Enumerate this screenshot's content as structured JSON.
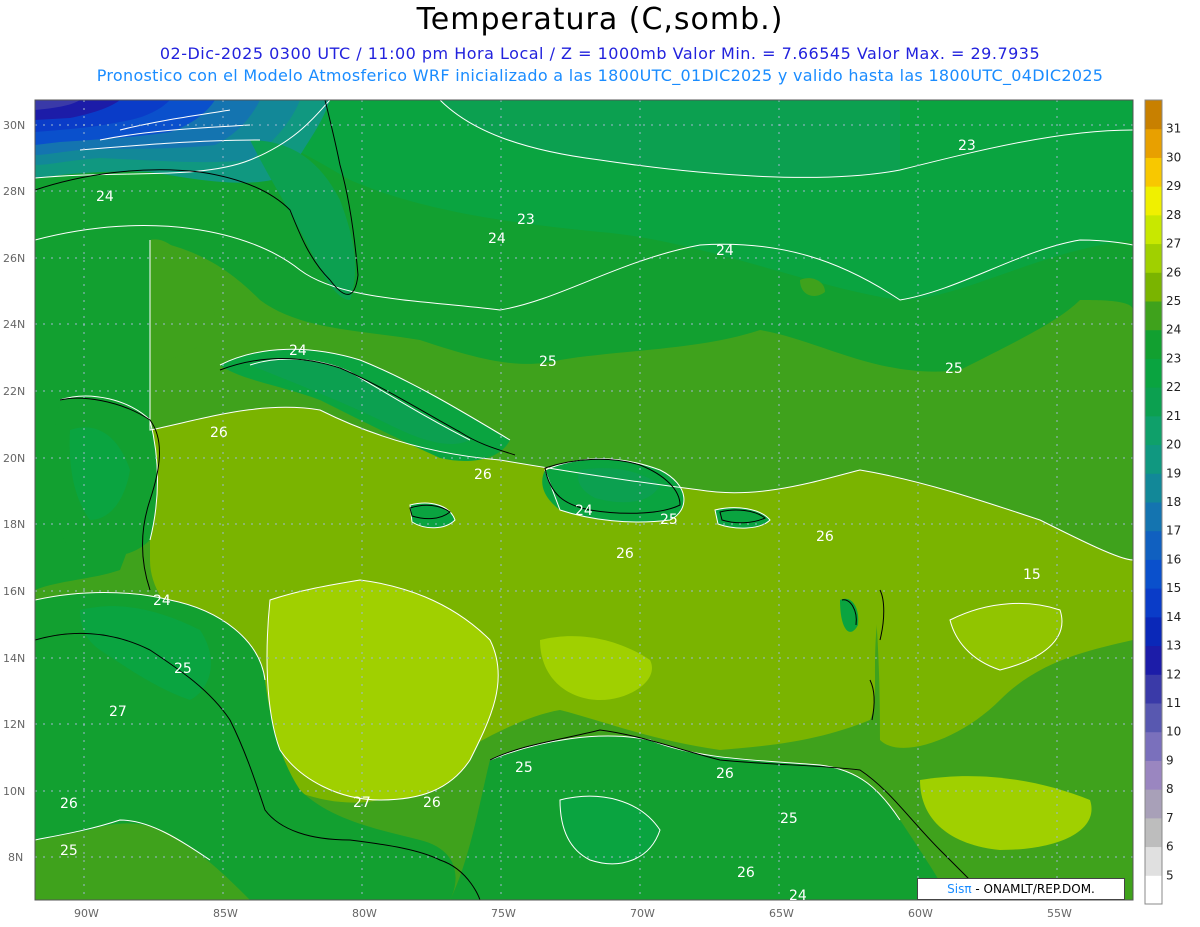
{
  "header": {
    "title": "Temperatura (C,somb.)",
    "line1": "02-Dic-2025 0300 UTC / 11:00 pm Hora Local / Z = 1000mb  Valor Min. = 7.66545  Valor Max. = 29.7935",
    "line2": "Pronostico con el Modelo Atmosferico WRF inicializado a las 1800UTC_01DIC2025 y valido hasta las  1800UTC_04DIC2025"
  },
  "map": {
    "lat_ticks": [
      "30N",
      "28N",
      "26N",
      "24N",
      "22N",
      "20N",
      "18N",
      "16N",
      "14N",
      "12N",
      "10N",
      "8N"
    ],
    "lon_ticks": [
      "90W",
      "85W",
      "80W",
      "75W",
      "70W",
      "65W",
      "60W",
      "55W"
    ],
    "contour_labels": [
      "24",
      "23",
      "24",
      "24",
      "23",
      "24",
      "25",
      "25",
      "26",
      "26",
      "24",
      "25",
      "26",
      "26",
      "15",
      "24",
      "25",
      "27",
      "26",
      "27",
      "26",
      "25",
      "25",
      "26",
      "25",
      "26",
      "24"
    ]
  },
  "colorbar": {
    "levels": [
      5,
      6,
      7,
      8,
      9,
      10,
      11,
      12,
      13,
      14,
      15,
      16,
      17,
      18,
      19,
      20,
      21,
      22,
      23,
      24,
      25,
      26,
      27,
      28,
      29,
      30,
      31
    ],
    "labels": [
      "5",
      "6",
      "7",
      "8",
      "9",
      "10",
      "11",
      "12",
      "13",
      "14",
      "15",
      "16",
      "17",
      "18",
      "19",
      "20",
      "21",
      "22",
      "23",
      "24",
      "25",
      "26",
      "27",
      "28",
      "29",
      "30",
      "31"
    ],
    "colors": [
      "#ffffff",
      "#e0e0e0",
      "#bdbdbd",
      "#a8a0b8",
      "#9a86c0",
      "#7a70bc",
      "#5858b0",
      "#3a3aa8",
      "#1c1ca8",
      "#0a28b8",
      "#0a3cc8",
      "#0a50cc",
      "#1060c0",
      "#1474b0",
      "#128898",
      "#109880",
      "#0fa06a",
      "#0ca050",
      "#0aa440",
      "#12a030",
      "#3fa21c",
      "#7ab400",
      "#a0d000",
      "#c8e800",
      "#f0f000",
      "#f8c800",
      "#e8a000",
      "#c88000"
    ]
  },
  "credit": {
    "sis": "Sisπ",
    "text": " - ONAMLT/REP.DOM."
  }
}
